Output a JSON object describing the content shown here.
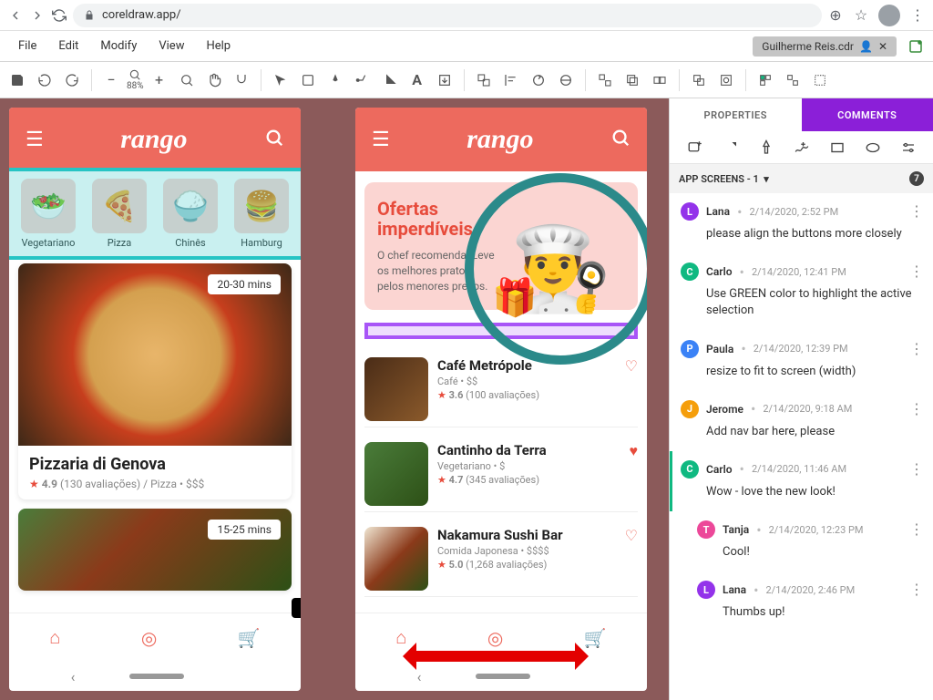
{
  "browser": {
    "url": "coreldraw.app/"
  },
  "menubar": {
    "items": [
      "File",
      "Edit",
      "Modify",
      "View",
      "Help"
    ],
    "filename": "Guilherme Reis.cdr"
  },
  "toolbar": {
    "zoom": "88%"
  },
  "panel": {
    "tabs": {
      "properties": "PROPERTIES",
      "comments": "COMMENTS"
    },
    "screens_label": "APP SCREENS - 1",
    "screens_count": "7"
  },
  "comments": [
    {
      "avatar": "L",
      "cls": "av-L",
      "author": "Lana",
      "date": "2/14/2020, 2:52 PM",
      "text": "please align the buttons more closely"
    },
    {
      "avatar": "C",
      "cls": "av-C",
      "author": "Carlo",
      "date": "2/14/2020, 12:41 PM",
      "text": "Use GREEN color to highlight the active selection"
    },
    {
      "avatar": "P",
      "cls": "av-P",
      "author": "Paula",
      "date": "2/14/2020, 12:39 PM",
      "text": "resize to fit to screen (width)"
    },
    {
      "avatar": "J",
      "cls": "av-J",
      "author": "Jerome",
      "date": "2/14/2020, 9:18 AM",
      "text": "Add nav bar here, please"
    },
    {
      "avatar": "C",
      "cls": "av-C",
      "author": "Carlo",
      "date": "2/14/2020, 11:46 AM",
      "text": "Wow - love the new look!",
      "accent": true
    },
    {
      "avatar": "T",
      "cls": "av-T",
      "author": "Tanja",
      "date": "2/14/2020, 12:23 PM",
      "text": "Cool!",
      "reply": true
    },
    {
      "avatar": "L",
      "cls": "av-L",
      "author": "Lana",
      "date": "2/14/2020, 2:46 PM",
      "text": "Thumbs up!",
      "reply": true
    }
  ],
  "phone1": {
    "logo": "rango",
    "categories": [
      {
        "emoji": "🥗",
        "label": "Vegetariano"
      },
      {
        "emoji": "🍕",
        "label": "Pizza"
      },
      {
        "emoji": "🍚",
        "label": "Chinês"
      },
      {
        "emoji": "🍔",
        "label": "Hamburg"
      }
    ],
    "card1": {
      "time": "20-30 mins",
      "title": "Pizzaria di Genova",
      "rating": "4.9",
      "meta": "(130 avaliações) / Pizza  •  $$$"
    },
    "card2": {
      "time": "15-25 mins"
    }
  },
  "phone2": {
    "logo": "rango",
    "offer": {
      "title1": "Ofertas",
      "title2": "imperdíveis",
      "text": "O chef recomenda: Leve os melhores pratos pelos menores preços."
    },
    "restaurants": [
      {
        "title": "Café Metrópole",
        "cat": "Café  •  $$",
        "rating": "3.6",
        "reviews": "(100 avaliações)",
        "img": "coffee"
      },
      {
        "title": "Cantinho da Terra",
        "cat": "Vegetariano  •  $",
        "rating": "4.7",
        "reviews": "(345 avaliações)",
        "img": "veg"
      },
      {
        "title": "Nakamura Sushi Bar",
        "cat": "Comida Japonesa  •  $$$$",
        "rating": "5.0",
        "reviews": "(1,268 avaliações)",
        "img": "sushi"
      }
    ]
  }
}
